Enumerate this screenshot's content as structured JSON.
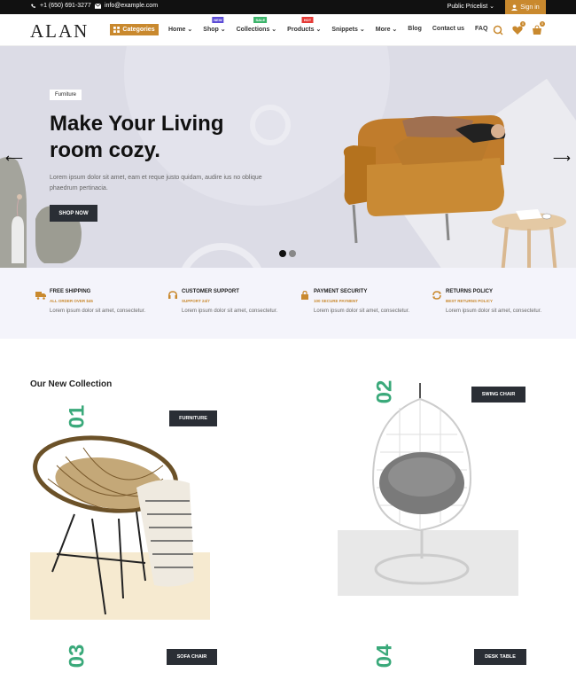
{
  "topbar": {
    "phone": "+1 (650) 691-3277",
    "email": "info@example.com",
    "pricelist": "Public Pricelist",
    "signin": "Sign in"
  },
  "header": {
    "logo": "ALAN",
    "categories": "Categories",
    "nav": [
      {
        "label": "Home",
        "badge": "",
        "badge_color": ""
      },
      {
        "label": "Shop",
        "badge": "NEW",
        "badge_color": "#5b4bd6"
      },
      {
        "label": "Collections",
        "badge": "SALE",
        "badge_color": "#3bb46a"
      },
      {
        "label": "Products",
        "badge": "HOT",
        "badge_color": "#e53935"
      },
      {
        "label": "Snippets",
        "badge": "",
        "badge_color": ""
      },
      {
        "label": "More",
        "badge": "",
        "badge_color": ""
      },
      {
        "label": "Blog",
        "badge": "",
        "badge_color": ""
      },
      {
        "label": "Contact us",
        "badge": "",
        "badge_color": ""
      },
      {
        "label": "FAQ",
        "badge": "",
        "badge_color": ""
      }
    ],
    "wishlist_count": "0",
    "cart_count": "0"
  },
  "hero": {
    "tag": "Furniture",
    "title": "Make Your Living room cozy.",
    "description": "Lorem ipsum dolor sit amet, eam et reque justo quidam, audire ius no oblique phaedrum pertinacia.",
    "button": "SHOP NOW"
  },
  "features": [
    {
      "title": "FREE SHIPPING",
      "subtitle": "ALL ORDER OVER $45",
      "desc": "Lorem ipsum dolor sit amet, consectetur.",
      "icon": "truck-icon"
    },
    {
      "title": "CUSTOMER SUPPORT",
      "subtitle": "SUPPORT 24/7",
      "desc": "Lorem ipsum dolor sit amet, consectetur.",
      "icon": "headset-icon"
    },
    {
      "title": "PAYMENT SECURITY",
      "subtitle": "100 SECURE PAYMENT",
      "desc": "Lorem ipsum dolor sit amet, consectetur.",
      "icon": "lock-icon"
    },
    {
      "title": "RETURNS POLICY",
      "subtitle": "BEST RETURNS POLICY",
      "desc": "Lorem ipsum dolor sit amet, consectetur.",
      "icon": "refresh-icon"
    }
  ],
  "collection": {
    "title": "Our New Collection",
    "items": [
      {
        "num": "01",
        "label": "FURNITURE"
      },
      {
        "num": "02",
        "label": "SWING CHAIR"
      },
      {
        "num": "03",
        "label": "SOFA CHAIR"
      },
      {
        "num": "04",
        "label": "DESK TABLE"
      }
    ]
  },
  "colors": {
    "accent": "#c9892e",
    "dark": "#2a2e35",
    "green": "#3aa97a"
  }
}
